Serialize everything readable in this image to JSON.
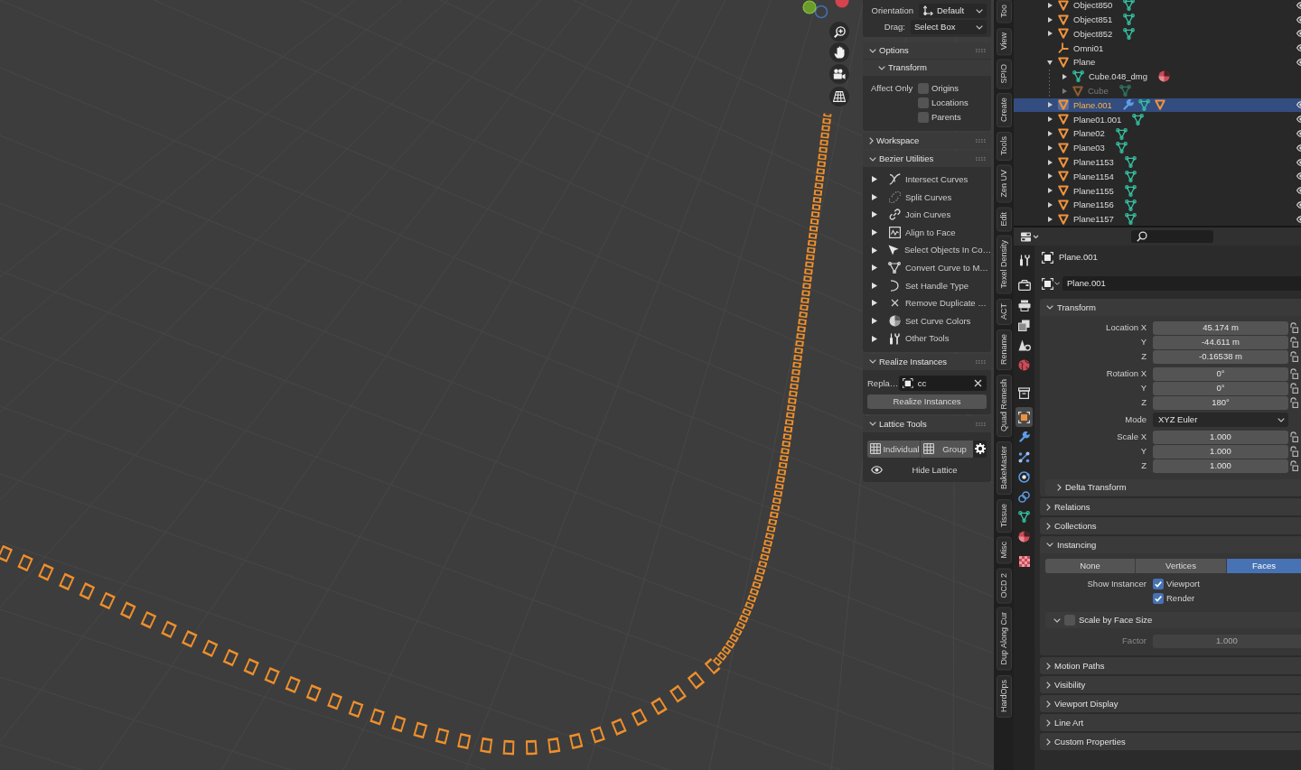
{
  "tool_settings": [
    {
      "kind": "orientation",
      "label": "Orientation",
      "value": "Default"
    },
    {
      "kind": "plain",
      "label": "Drag:",
      "value": "Select Box"
    }
  ],
  "sidebar": {
    "options": {
      "title": "Options",
      "expanded": true,
      "transform": {
        "title": "Transform",
        "expanded": true,
        "label": "Affect Only",
        "checks": [
          {
            "label": "Origins",
            "checked": false
          },
          {
            "label": "Locations",
            "checked": false
          },
          {
            "label": "Parents",
            "checked": false
          }
        ]
      }
    },
    "workspace": {
      "title": "Workspace",
      "expanded": false
    },
    "bezier": {
      "title": "Bezier Utilities",
      "expanded": true,
      "items": [
        {
          "kind": "intersect",
          "label": "Intersect Curves",
          "expanded": false
        },
        {
          "kind": "split",
          "label": "Split Curves",
          "expanded": false
        },
        {
          "kind": "join",
          "label": "Join Curves",
          "expanded": false
        },
        {
          "kind": "align",
          "label": "Align to Face",
          "expanded": false
        },
        {
          "kind": "select",
          "label": "Select Objects In Co…",
          "expanded": false
        },
        {
          "kind": "convert",
          "label": "Convert Curve to M…",
          "expanded": false
        },
        {
          "kind": "handle",
          "label": "Set Handle Type",
          "expanded": false
        },
        {
          "kind": "remove",
          "label": "Remove Duplicate …",
          "expanded": false
        },
        {
          "kind": "colors",
          "label": "Set Curve Colors",
          "expanded": false
        },
        {
          "kind": "tools",
          "label": "Other Tools",
          "expanded": false
        }
      ]
    },
    "realize": {
      "title": "Realize Instances",
      "expanded": true,
      "field_label": "Repla…",
      "field_value": "cc",
      "button": "Realize Instances"
    },
    "lattice": {
      "title": "Lattice Tools",
      "expanded": true,
      "modes": [
        {
          "label": "Individual",
          "selected": false
        },
        {
          "label": "Group",
          "selected": false
        }
      ],
      "toggle": "Hide Lattice"
    }
  },
  "sidebar_tabs": [
    "Too",
    "View",
    "SPIO",
    "Create",
    "Tools",
    "Zen UV",
    "Edit",
    "Texel Density",
    "ACT",
    "Rename",
    "Quad Remesh",
    "BakeMaster",
    "Tissue",
    "Misc",
    "OCD 2",
    "Dup Along Cur",
    "HardOps"
  ],
  "outliner": {
    "rows": [
      {
        "name": "Object850",
        "kind": "object",
        "expanded": false,
        "selected": false,
        "dimmed": false,
        "extras": [
          {
            "kind": "mesh"
          }
        ]
      },
      {
        "name": "Object851",
        "kind": "object",
        "expanded": false,
        "selected": false,
        "dimmed": false,
        "extras": [
          {
            "kind": "mesh"
          }
        ]
      },
      {
        "name": "Object852",
        "kind": "object",
        "expanded": false,
        "selected": false,
        "dimmed": false,
        "extras": [
          {
            "kind": "mesh"
          }
        ]
      },
      {
        "name": "Omni01",
        "kind": "light",
        "selected": false,
        "dimmed": false
      },
      {
        "name": "Plane",
        "kind": "object",
        "expanded": true,
        "selected": false,
        "dimmed": false,
        "children": [
          {
            "name": "Cube.048_dmg",
            "kind": "mesh",
            "expanded": false,
            "selected": false,
            "dimmed": false,
            "extras": [
              {
                "kind": "material"
              }
            ]
          },
          {
            "name": "Cube",
            "kind": "object",
            "expanded": false,
            "selected": false,
            "dimmed": true,
            "extras": [
              {
                "kind": "mesh"
              }
            ]
          }
        ]
      },
      {
        "name": "Plane.001",
        "kind": "object",
        "expanded": false,
        "selected": true,
        "dimmed": false,
        "extras": [
          {
            "kind": "modifier"
          },
          {
            "kind": "mesh"
          },
          {
            "kind": "object"
          }
        ]
      },
      {
        "name": "Plane01.001",
        "kind": "object",
        "expanded": false,
        "selected": false,
        "dimmed": false,
        "extras": [
          {
            "kind": "mesh"
          }
        ]
      },
      {
        "name": "Plane02",
        "kind": "object",
        "expanded": false,
        "selected": false,
        "dimmed": false,
        "extras": [
          {
            "kind": "mesh"
          }
        ]
      },
      {
        "name": "Plane03",
        "kind": "object",
        "expanded": false,
        "selected": false,
        "dimmed": false,
        "extras": [
          {
            "kind": "mesh"
          }
        ]
      },
      {
        "name": "Plane1153",
        "kind": "object",
        "expanded": false,
        "selected": false,
        "dimmed": false,
        "extras": [
          {
            "kind": "mesh"
          }
        ]
      },
      {
        "name": "Plane1154",
        "kind": "object",
        "expanded": false,
        "selected": false,
        "dimmed": false,
        "extras": [
          {
            "kind": "mesh"
          }
        ]
      },
      {
        "name": "Plane1155",
        "kind": "object",
        "expanded": false,
        "selected": false,
        "dimmed": false,
        "extras": [
          {
            "kind": "mesh"
          }
        ]
      },
      {
        "name": "Plane1156",
        "kind": "object",
        "expanded": false,
        "selected": false,
        "dimmed": false,
        "extras": [
          {
            "kind": "mesh"
          }
        ]
      },
      {
        "name": "Plane1157",
        "kind": "object",
        "expanded": false,
        "selected": false,
        "dimmed": false,
        "extras": [
          {
            "kind": "mesh"
          }
        ]
      }
    ]
  },
  "properties": {
    "nav": [
      [
        {
          "kind": "tool",
          "selected": false
        }
      ],
      [
        {
          "kind": "render",
          "selected": false
        },
        {
          "kind": "output",
          "selected": false
        },
        {
          "kind": "view_layer",
          "selected": false
        },
        {
          "kind": "scene",
          "selected": false
        },
        {
          "kind": "world",
          "selected": false
        }
      ],
      [
        {
          "kind": "collection",
          "selected": false
        }
      ],
      [
        {
          "kind": "object",
          "selected": true
        },
        {
          "kind": "modifiers",
          "selected": false
        },
        {
          "kind": "particles",
          "selected": false
        },
        {
          "kind": "physics",
          "selected": false
        },
        {
          "kind": "constraints",
          "selected": false
        },
        {
          "kind": "data",
          "selected": false
        },
        {
          "kind": "material",
          "selected": false
        }
      ],
      [
        {
          "kind": "texture",
          "selected": false
        }
      ]
    ],
    "context": "Plane.001",
    "datablock": "Plane.001",
    "panels": [
      {
        "kind": "transform",
        "title": "Transform",
        "expanded": true,
        "groups": [
          [
            {
              "kind": "number",
              "label": "Location X",
              "value": "45.174 m",
              "locked": false
            },
            {
              "kind": "number",
              "label": "Y",
              "value": "-44.611 m",
              "locked": false
            },
            {
              "kind": "number",
              "label": "Z",
              "value": "-0.16538 m",
              "locked": false
            }
          ],
          [
            {
              "kind": "number",
              "label": "Rotation X",
              "value": "0°",
              "locked": false
            },
            {
              "kind": "number",
              "label": "Y",
              "value": "0°",
              "locked": false
            },
            {
              "kind": "number",
              "label": "Z",
              "value": "180°",
              "locked": false
            }
          ],
          [
            {
              "kind": "dropdown",
              "label": "Mode",
              "value": "XYZ Euler"
            }
          ],
          [
            {
              "kind": "number",
              "label": "Scale X",
              "value": "1.000",
              "locked": false
            },
            {
              "kind": "number",
              "label": "Y",
              "value": "1.000",
              "locked": false
            },
            {
              "kind": "number",
              "label": "Z",
              "value": "1.000",
              "locked": false
            }
          ]
        ],
        "subpanels": [
          {
            "title": "Delta Transform",
            "expanded": false
          }
        ]
      },
      {
        "kind": "plain",
        "title": "Relations",
        "expanded": false
      },
      {
        "kind": "plain",
        "title": "Collections",
        "expanded": false
      },
      {
        "kind": "instancing",
        "title": "Instancing",
        "expanded": true,
        "options": [
          {
            "label": "None",
            "selected": false
          },
          {
            "label": "Vertices",
            "selected": false
          },
          {
            "label": "Faces",
            "selected": true
          }
        ],
        "show_label": "Show Instancer",
        "checks": [
          {
            "label": "Viewport",
            "checked": true
          },
          {
            "label": "Render",
            "checked": true
          }
        ],
        "subpanel": {
          "title": "Scale by Face Size",
          "expanded": true,
          "checked": false,
          "rows": [
            {
              "label": "Factor",
              "value": "1.000",
              "disabled": true
            }
          ]
        }
      },
      {
        "kind": "plain",
        "title": "Motion Paths",
        "expanded": false
      },
      {
        "kind": "plain",
        "title": "Visibility",
        "expanded": false
      },
      {
        "kind": "plain",
        "title": "Viewport Display",
        "expanded": false
      },
      {
        "kind": "plain",
        "title": "Line Art",
        "expanded": false
      },
      {
        "kind": "plain",
        "title": "Custom Properties",
        "expanded": false
      }
    ]
  }
}
